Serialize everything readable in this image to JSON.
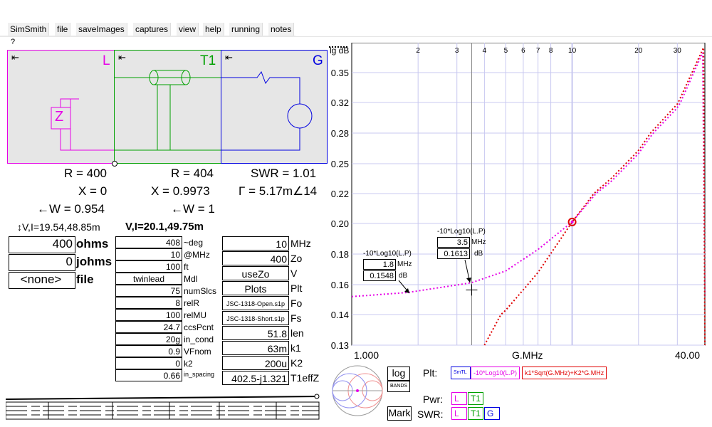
{
  "menu": [
    "SimSmith",
    "file",
    "saveImages",
    "captures",
    "view",
    "help",
    "running",
    "notes"
  ],
  "help_mark": "?",
  "blocks": {
    "L": {
      "label": "L",
      "arrow": "⇤",
      "color": "#e600e6"
    },
    "T1": {
      "label": "T1",
      "arrow": "⇤",
      "color": "#00a000"
    },
    "G": {
      "label": "G",
      "arrow": "⇤",
      "color": "#0000e0"
    },
    "component_label": "Z"
  },
  "readouts": {
    "L": {
      "R": "R = 400",
      "X": "X = 0",
      "W": "←W = 0.954",
      "VI": "↕V,I=19.54,48.85m"
    },
    "T1": {
      "R": "R = 404",
      "X": "X = 0.9973",
      "W": "←W = 1",
      "VI": "V,I=20.1,49.75m"
    },
    "G": {
      "SWR": "SWR = 1.01",
      "Gamma": "Γ = 5.17m∠14"
    }
  },
  "load_inputs": [
    {
      "value": "400",
      "label": "ohms"
    },
    {
      "value": "0",
      "label": "johms"
    },
    {
      "value": "<none>",
      "label": "file"
    }
  ],
  "t1_params": [
    {
      "value": "408",
      "label": "~deg"
    },
    {
      "value": "10",
      "label": "@MHz"
    },
    {
      "value": "100",
      "label": "ft"
    },
    {
      "value": "twinlead",
      "label": "Mdl"
    },
    {
      "value": "75",
      "label": "numSlcs"
    },
    {
      "value": "8",
      "label": "relR"
    },
    {
      "value": "100",
      "label": "relMU"
    },
    {
      "value": "24.7",
      "label": "ccsPcnt"
    },
    {
      "value": "20g",
      "label": "in_cond"
    },
    {
      "value": "0.9",
      "label": "VFnom"
    },
    {
      "value": "0",
      "label": "k2"
    },
    {
      "value": "0.66",
      "label": "in_spacing"
    }
  ],
  "g_params": [
    {
      "value": "10",
      "label": "MHz"
    },
    {
      "value": "400",
      "label": "Zo"
    },
    {
      "value": "useZo",
      "label": "V"
    },
    {
      "value": "Plots",
      "label": "Plt"
    },
    {
      "value": "JSC-1318-Open.s1p",
      "label": "Fo"
    },
    {
      "value": "JSC-1318-Short.s1p",
      "label": "Fs"
    },
    {
      "value": "51.8",
      "label": "len"
    },
    {
      "value": "63m",
      "label": "k1"
    },
    {
      "value": "200u",
      "label": "K2"
    },
    {
      "value": "402.5-j1.321",
      "label": "T1effZ"
    }
  ],
  "chart": {
    "ylabel": "lg dB",
    "xlabel": "G.MHz",
    "x_min_label": "1.000",
    "x_max_label": "40.00",
    "yticks": [
      "0.35",
      "0.32",
      "0.28",
      "0.25",
      "0.22",
      "0.20",
      "0.18",
      "0.16",
      "0.14",
      "0.13"
    ],
    "xticks": [
      "2",
      "3",
      "4",
      "5",
      "6",
      "7",
      "8",
      "10",
      "20",
      "30"
    ],
    "annotations": [
      {
        "title": "-10*Log10(L.P)",
        "freq": "1.8",
        "freq_unit": "MHz",
        "db": "0.1548",
        "db_unit": "dB"
      },
      {
        "title": "-10*Log10(L.P)",
        "freq": "3.5",
        "freq_unit": "MHz",
        "db": "0.1613",
        "db_unit": "dB"
      }
    ],
    "colors": {
      "magenta": "#e600e6",
      "red": "#e00000",
      "grid": "#c8c8f0",
      "blue": "#0000e0"
    }
  },
  "chart_data": {
    "type": "line",
    "xlabel": "G.MHz",
    "ylabel": "lg dB",
    "xscale": "log",
    "xlim": [
      1,
      40
    ],
    "ylim": [
      0.13,
      0.37
    ],
    "series": [
      {
        "name": "-10*Log10(L.P)",
        "x": [
          1,
          1.8,
          3.5,
          5,
          7,
          10,
          15,
          20,
          30,
          40
        ],
        "y": [
          0.152,
          0.1548,
          0.1613,
          0.169,
          0.183,
          0.201,
          0.232,
          0.26,
          0.313,
          0.375
        ]
      },
      {
        "name": "k1*Sqrt(G.MHz)+K2*G.MHz",
        "x": [
          4,
          5,
          7,
          10,
          15,
          20,
          30,
          40
        ],
        "y": [
          0.13,
          0.143,
          0.168,
          0.201,
          0.235,
          0.263,
          0.318,
          0.378
        ]
      }
    ]
  },
  "controls": {
    "log": "log",
    "bands": "BANDS",
    "mark": "Mark",
    "plt": "Plt:",
    "pwr": "Pwr:",
    "swr": "SWR:",
    "legend": [
      "SmTL",
      "-10*Log10(L.P)",
      "k1*Sqrt(G.MHz)+K2*G.MHz"
    ],
    "pwr_boxes": [
      "L",
      "T1"
    ],
    "swr_boxes": [
      "L",
      "T1",
      "G"
    ]
  }
}
